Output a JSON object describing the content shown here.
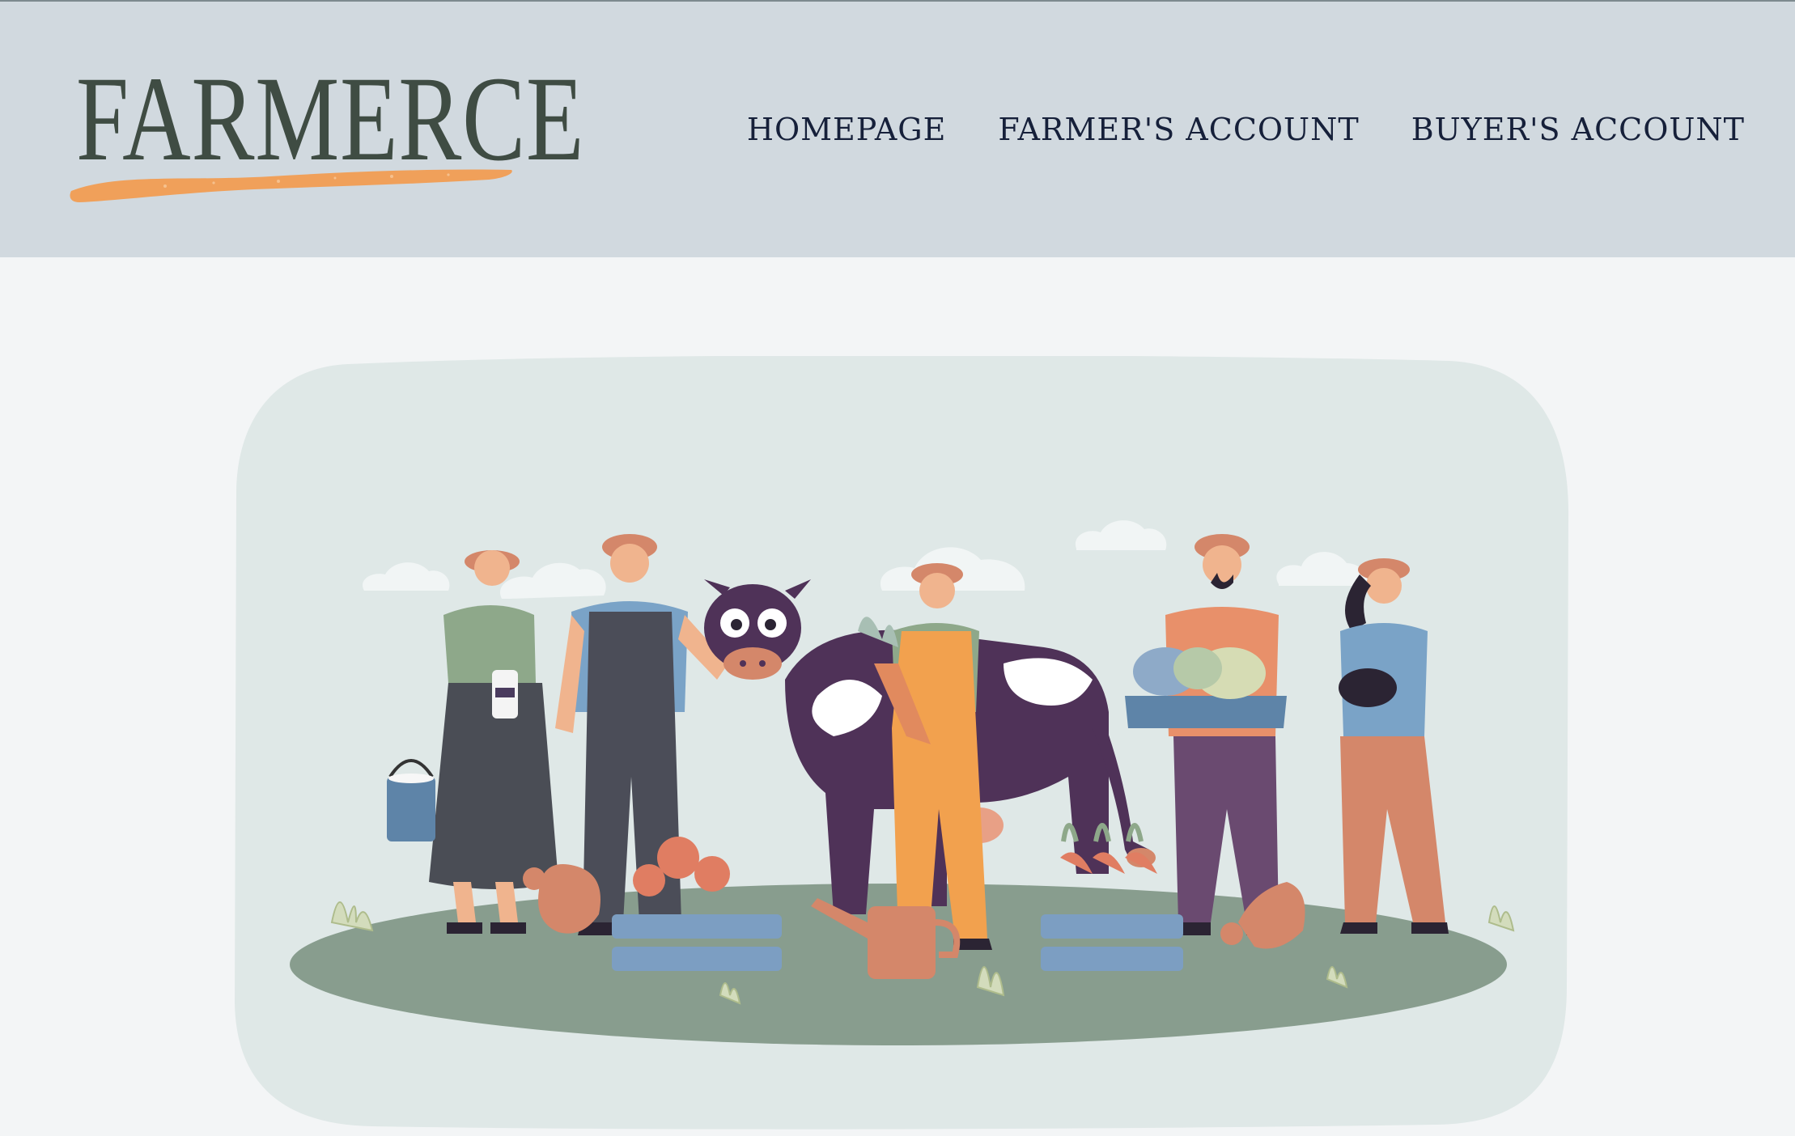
{
  "brand": {
    "name": "FARMERCE",
    "colors": {
      "header_bg": "#d1d9df",
      "logo_text": "#3f4c43",
      "logo_swash": "#f0a05a",
      "nav_text": "#16203a"
    }
  },
  "nav": {
    "items": [
      {
        "label": "HOMEPAGE"
      },
      {
        "label": "FARMER'S ACCOUNT"
      },
      {
        "label": "BUYER'S ACCOUNT"
      }
    ]
  },
  "hero": {
    "illustration": "farmers-with-cow-illustration"
  }
}
